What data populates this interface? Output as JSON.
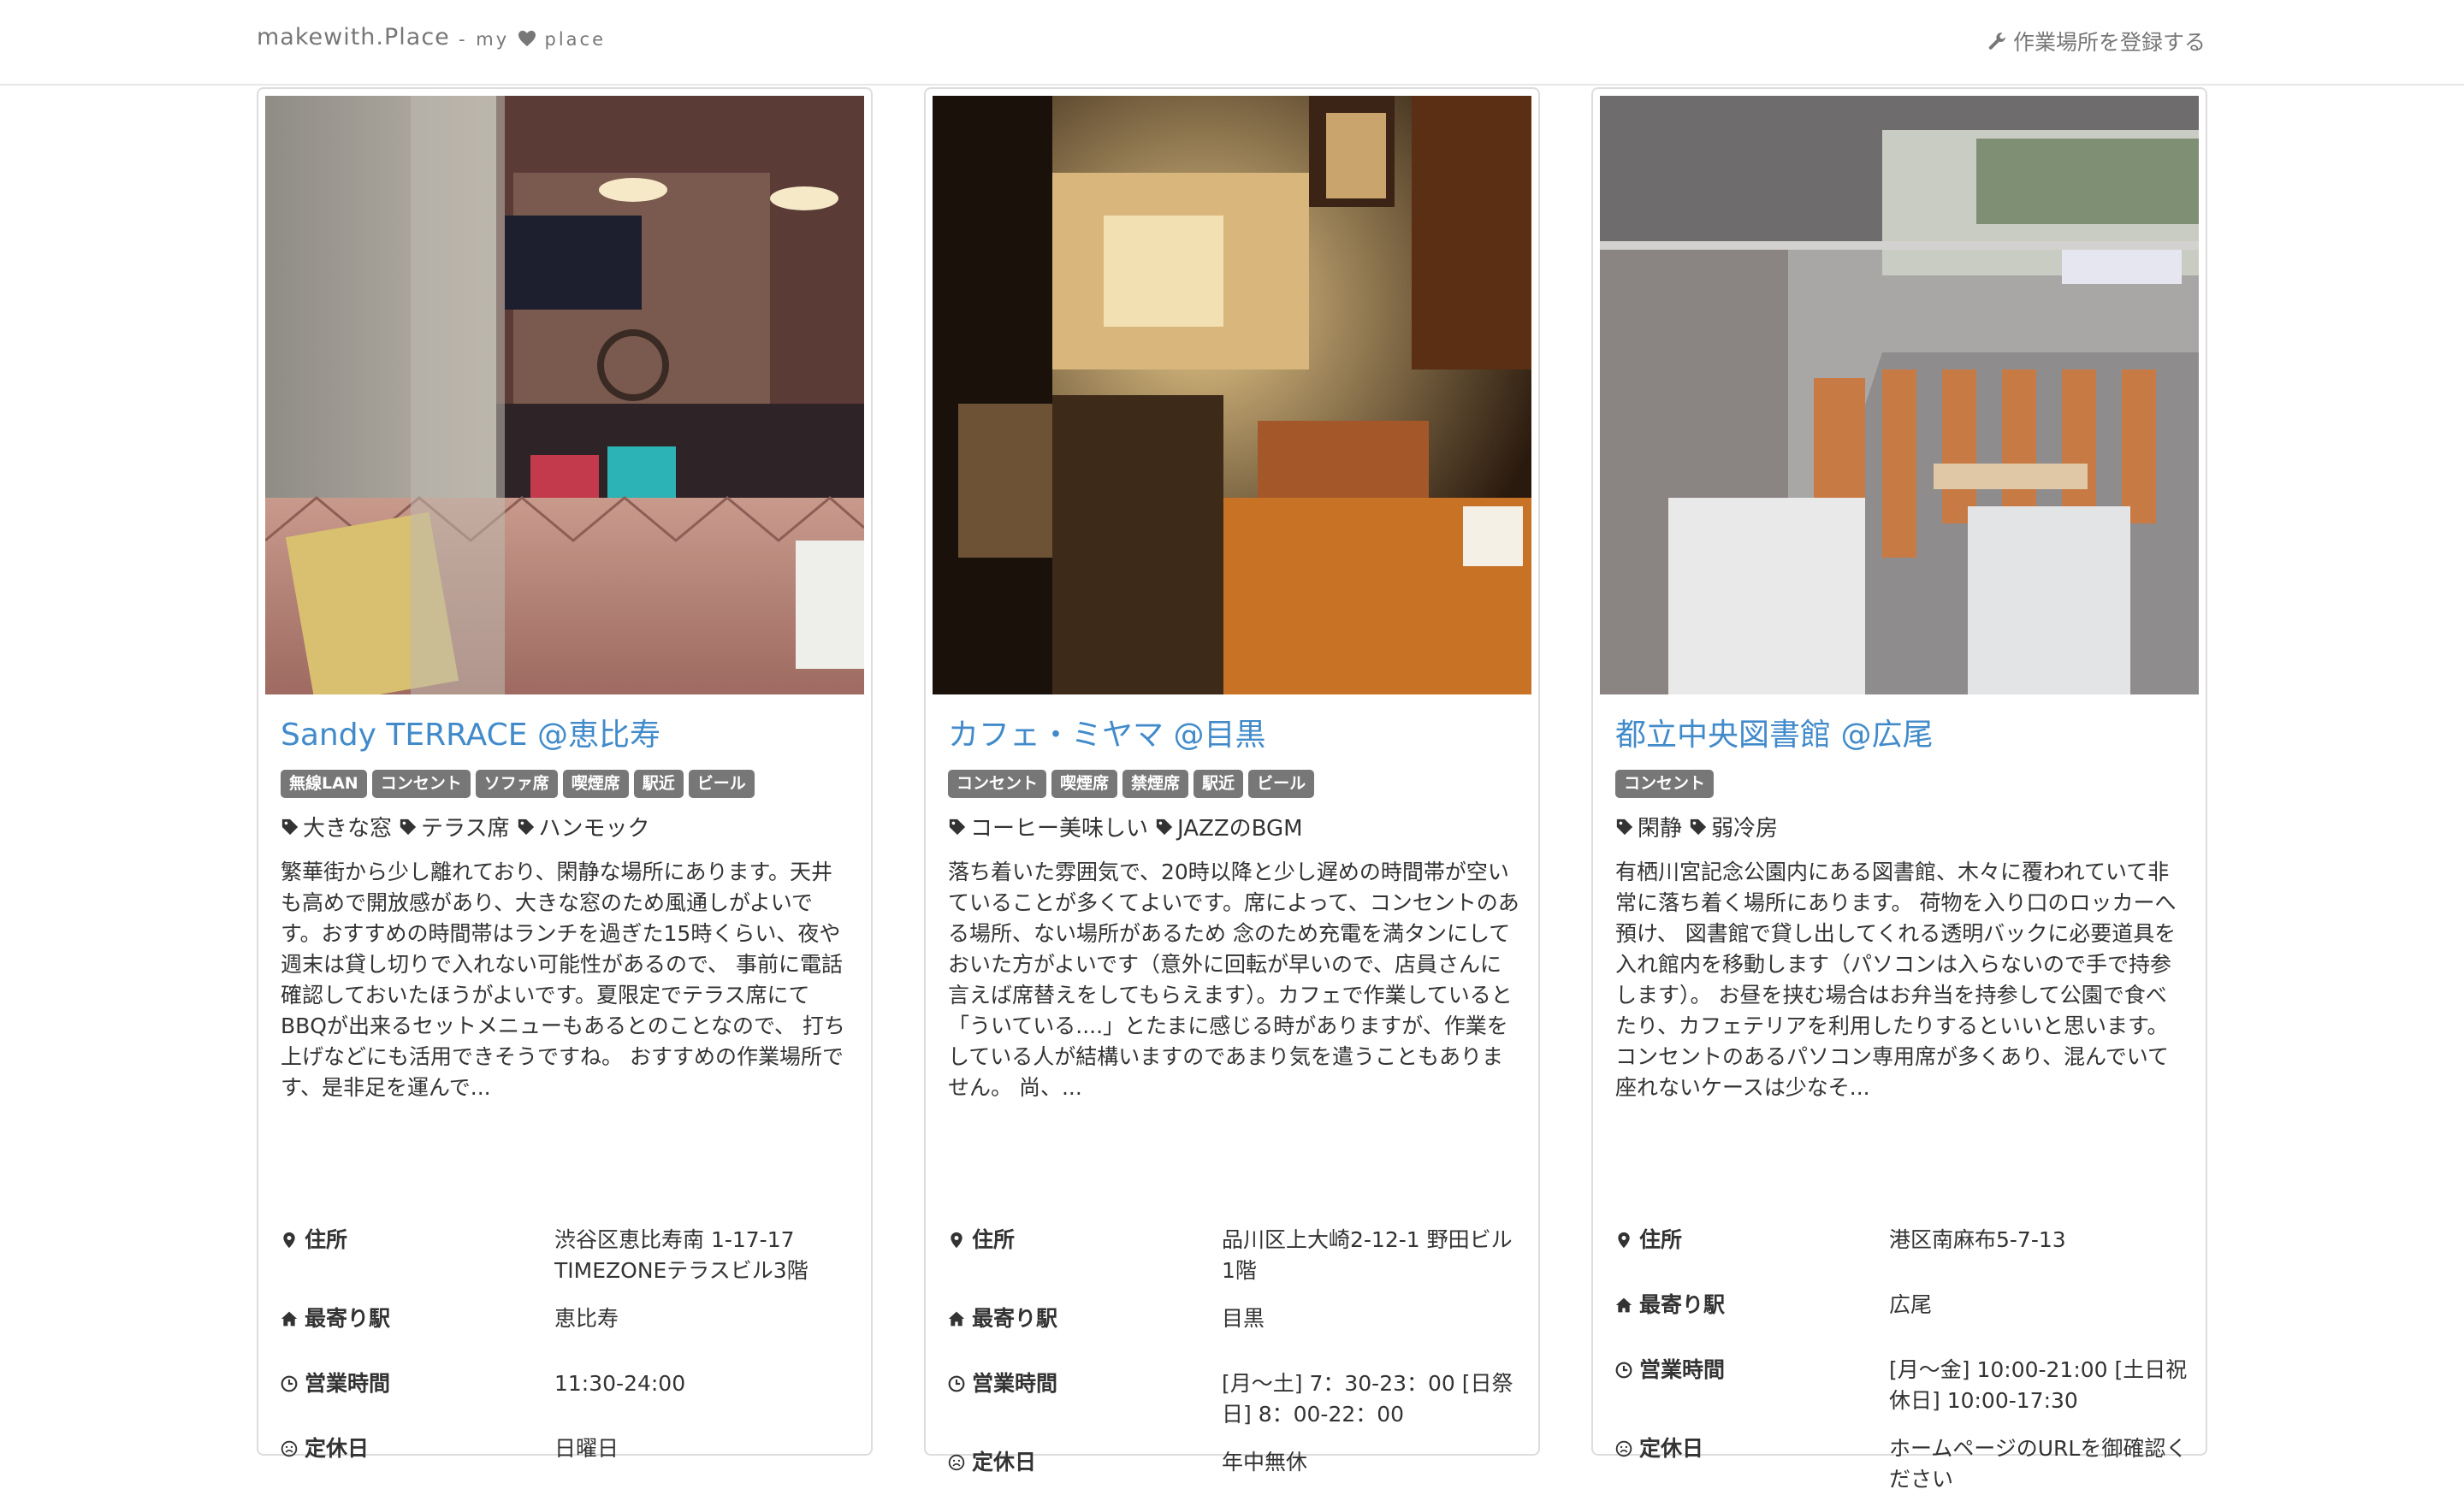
{
  "navbar": {
    "brand": "makewith.Place",
    "tagline_prefix": "- my",
    "tagline_suffix": "place",
    "register_label": "作業場所を登録する"
  },
  "cards": [
    {
      "title": "Sandy TERRACE @恵比寿",
      "labels": [
        "無線LAN",
        "コンセント",
        "ソファ席",
        "喫煙席",
        "駅近",
        "ビール"
      ],
      "tags": [
        "大きな窓",
        "テラス席",
        "ハンモック"
      ],
      "description": "繁華街から少し離れており、閑静な場所にあります。天井も高めで開放感があり、大きな窓のため風通しがよいです。おすすめの時間帯はランチを過ぎた15時くらい、夜や週末は貸し切りで入れない可能性があるので、 事前に電話確認しておいたほうがよいです。夏限定でテラス席にてBBQが出来るセットメニューもあるとのことなので、 打ち上げなどにも活用できそうですね。 おすすめの作業場所です、是非足を運んで...",
      "address_label": "住所",
      "address": "渋谷区恵比寿南 1-17-17 TIMEZONEテラスビル3階",
      "station_label": "最寄り駅",
      "station": "恵比寿",
      "hours_label": "営業時間",
      "hours": "11:30-24:00",
      "closed_label": "定休日",
      "closed": "日曜日"
    },
    {
      "title": "カフェ・ミヤマ @目黒",
      "labels": [
        "コンセント",
        "喫煙席",
        "禁煙席",
        "駅近",
        "ビール"
      ],
      "tags": [
        "コーヒー美味しい",
        "JAZZのBGM"
      ],
      "description": "落ち着いた雰囲気で、20時以降と少し遅めの時間帯が空いていることが多くてよいです。席によって、コンセントのある場所、ない場所があるため 念のため充電を満タンにしておいた方がよいです（意外に回転が早いので、店員さんに言えば席替えをしてもらえます）。カフェで作業していると「ういている....」とたまに感じる時がありますが、作業をしている人が結構いますのであまり気を遣うこともありません。 尚、...",
      "address_label": "住所",
      "address": "品川区上大崎2-12-1 野田ビル1階",
      "station_label": "最寄り駅",
      "station": "目黒",
      "hours_label": "営業時間",
      "hours": "[月〜土] 7：30-23：00 [日祭日] 8：00-22：00",
      "closed_label": "定休日",
      "closed": "年中無休"
    },
    {
      "title": "都立中央図書館 @広尾",
      "labels": [
        "コンセント"
      ],
      "tags": [
        "閑静",
        "弱冷房"
      ],
      "description": "有栖川宮記念公園内にある図書館、木々に覆われていて非常に落ち着く場所にあります。 荷物を入り口のロッカーへ預け、 図書館で貸し出してくれる透明バックに必要道具を入れ館内を移動します（パソコンは入らないので手で持参します）。 お昼を挟む場合はお弁当を持参して公園で食べたり、カフェテリアを利用したりするといいと思います。 コンセントのあるパソコン専用席が多くあり、混んでいて座れないケースは少なそ...",
      "address_label": "住所",
      "address": "港区南麻布5-7-13",
      "station_label": "最寄り駅",
      "station": "広尾",
      "hours_label": "営業時間",
      "hours": "[月〜金] 10:00-21:00 [土日祝休日] 10:00-17:30",
      "closed_label": "定休日",
      "closed": "ホームページのURLを御確認ください"
    }
  ]
}
